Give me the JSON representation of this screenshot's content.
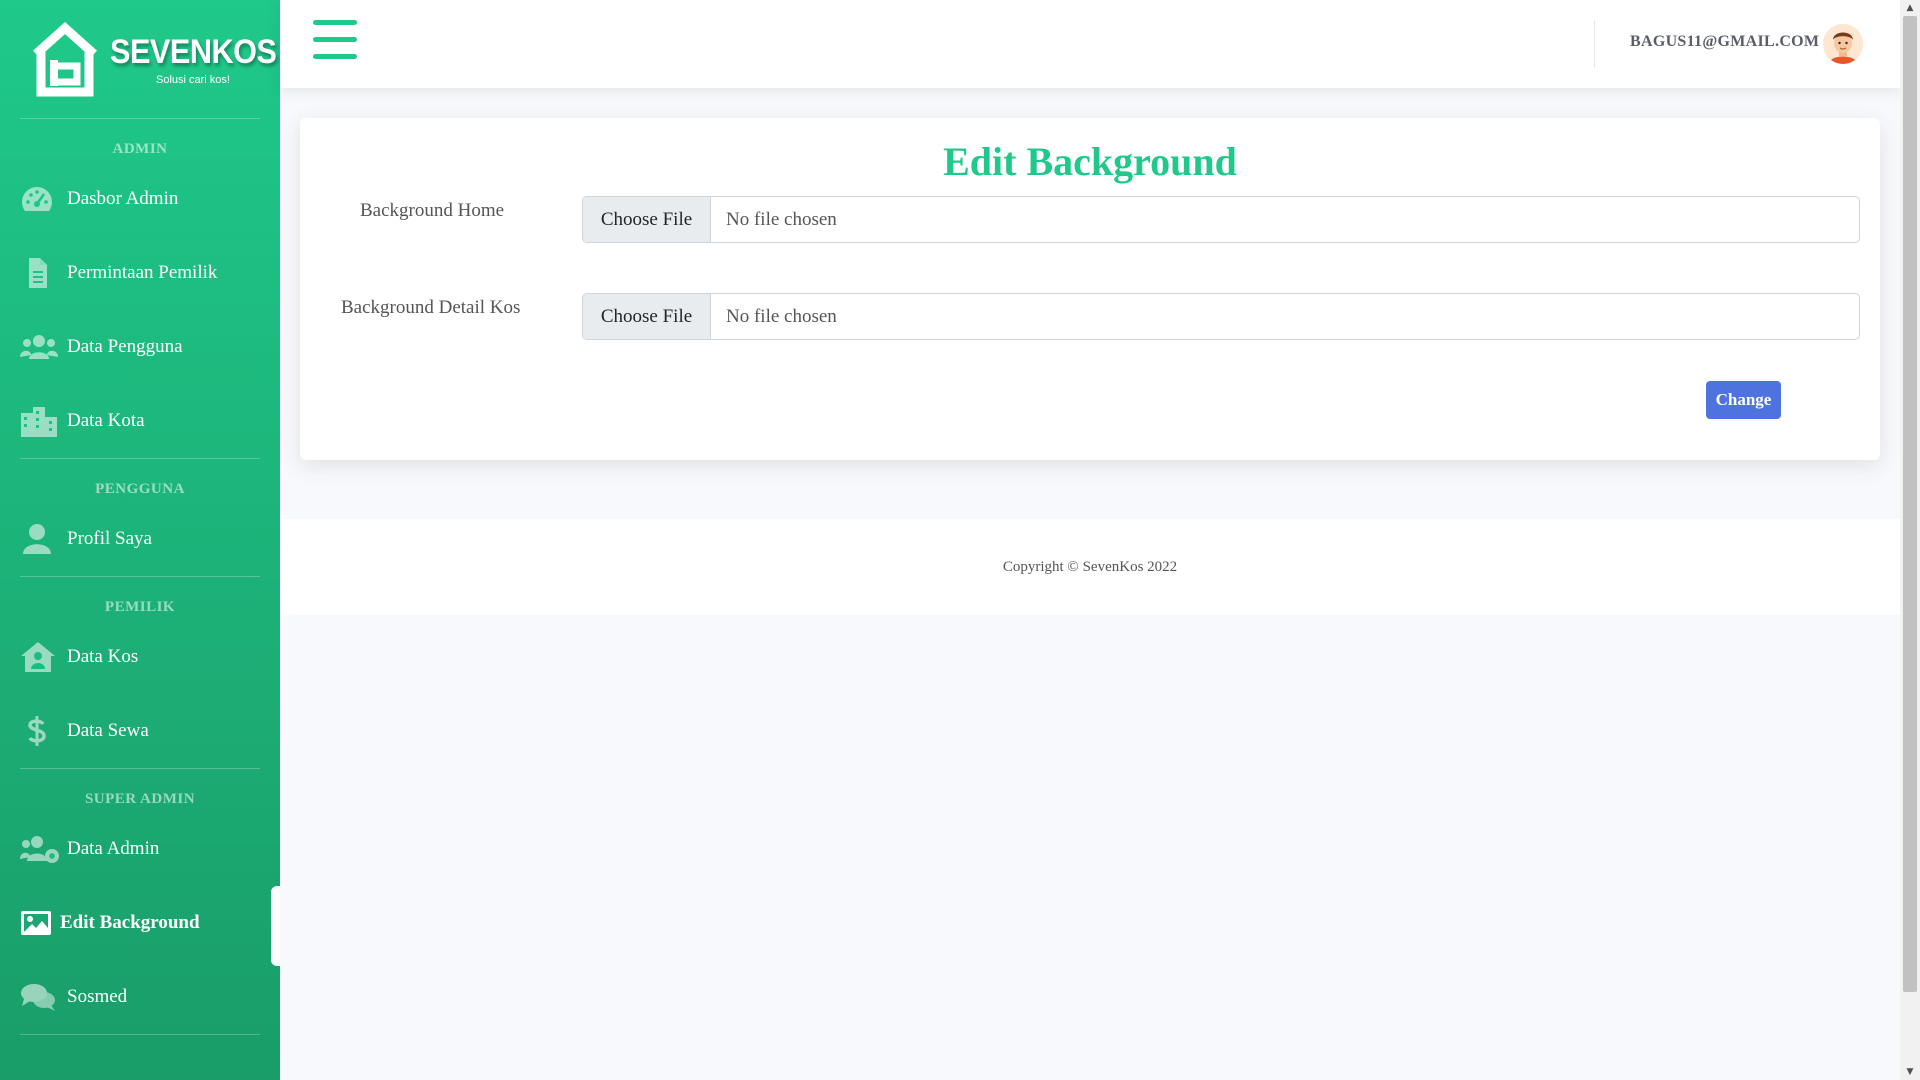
{
  "brand": {
    "name": "SEVENKOS",
    "tagline": "Solusi cari kos!"
  },
  "sidebar": {
    "sections": [
      {
        "heading": "ADMIN",
        "items": [
          {
            "label": "Dasbor Admin",
            "icon": "tachometer-icon"
          },
          {
            "label": "Permintaan Pemilik",
            "icon": "file-icon"
          },
          {
            "label": "Data Pengguna",
            "icon": "users-icon"
          },
          {
            "label": "Data Kota",
            "icon": "city-icon"
          }
        ]
      },
      {
        "heading": "PENGGUNA",
        "items": [
          {
            "label": "Profil Saya",
            "icon": "user-icon"
          }
        ]
      },
      {
        "heading": "PEMILIK",
        "items": [
          {
            "label": "Data Kos",
            "icon": "house-user-icon"
          },
          {
            "label": "Data Sewa",
            "icon": "dollar-icon"
          }
        ]
      },
      {
        "heading": "SUPER ADMIN",
        "items": [
          {
            "label": "Data Admin",
            "icon": "users-cog-icon"
          },
          {
            "label": "Edit Background",
            "icon": "image-icon",
            "active": true
          },
          {
            "label": "Sosmed",
            "icon": "comments-icon"
          }
        ]
      }
    ]
  },
  "topbar": {
    "user_email": "BAGUS11@GMAIL.COM"
  },
  "form": {
    "title": "Edit Background",
    "fields": [
      {
        "label": "Background Home",
        "button": "Choose File",
        "value": "No file chosen"
      },
      {
        "label": "Background Detail Kos",
        "button": "Choose File",
        "value": "No file chosen"
      }
    ],
    "submit_label": "Change"
  },
  "footer": {
    "copyright": "Copyright © SevenKos 2022"
  },
  "colors": {
    "accent": "#1fc98a",
    "primary_button": "#4e73df",
    "sidebar_top": "#1fc98a",
    "sidebar_bottom": "#1a9d68"
  }
}
